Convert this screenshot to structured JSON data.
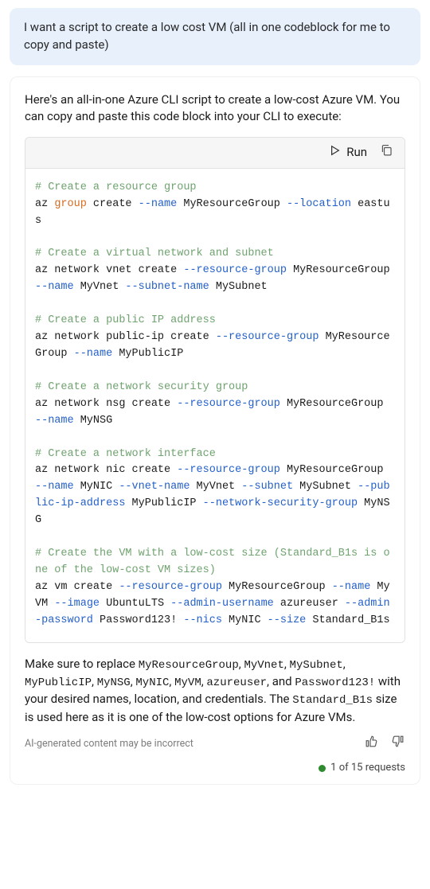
{
  "user_message": "I want a script to create a low cost VM (all in one codeblock for me to copy and paste)",
  "response_intro": "Here's an all-in-one Azure CLI script to create a low-cost Azure VM. You can copy and paste this code block into your CLI to execute:",
  "code_header": {
    "run_label": "Run"
  },
  "code": {
    "c1": "# Create a resource group",
    "l1a": "az ",
    "l1kw": "group",
    "l1b": " create ",
    "l1f1": "--name",
    "l1c": " MyResourceGroup ",
    "l1f2": "--location",
    "l1d": " eastus",
    "c2": "# Create a virtual network and subnet",
    "l2a": "az network vnet create ",
    "l2f1": "--resource-group",
    "l2b": " MyResourceGroup ",
    "l2f2": "--name",
    "l2c": " MyVnet ",
    "l2f3": "--subnet-name",
    "l2d": " MySubnet",
    "c3": "# Create a public IP address",
    "l3a": "az network public-ip create ",
    "l3f1": "--resource-group",
    "l3b": " MyResourceGroup ",
    "l3f2": "--name",
    "l3c": " MyPublicIP",
    "c4": "# Create a network security group",
    "l4a": "az network nsg create ",
    "l4f1": "--resource-group",
    "l4b": " MyResourceGroup ",
    "l4f2": "--name",
    "l4c": " MyNSG",
    "c5": "# Create a network interface",
    "l5a": "az network nic create ",
    "l5f1": "--resource-group",
    "l5b": " MyResourceGroup ",
    "l5f2": "--name",
    "l5c": " MyNIC ",
    "l5f3": "--vnet-name",
    "l5d": " MyVnet ",
    "l5f4": "--subnet",
    "l5e": " MySubnet ",
    "l5f5": "--public-ip-address",
    "l5g": " MyPublicIP ",
    "l5f6": "--network-security-group",
    "l5h": " MyNSG",
    "c6": "# Create the VM with a low-cost size (Standard_B1s is one of the low-cost VM sizes)",
    "l6a": "az vm create ",
    "l6f1": "--resource-group",
    "l6b": " MyResourceGroup ",
    "l6f2": "--name",
    "l6c": " MyVM ",
    "l6f3": "--image",
    "l6d": " UbuntuLTS ",
    "l6f4": "--admin-username",
    "l6e": " azureuser ",
    "l6f5": "--admin-password",
    "l6g": " Password123! ",
    "l6f6": "--nics",
    "l6h": " MyNIC ",
    "l6f7": "--size",
    "l6i": " Standard_B1s"
  },
  "outro": {
    "t1": "Make sure to replace ",
    "m1": "MyResourceGroup",
    "t2": ", ",
    "m2": "MyVnet",
    "t3": ", ",
    "m3": "MySubnet",
    "t4": ", ",
    "m4": "MyPublicIP",
    "t5": ", ",
    "m5": "MyNSG",
    "t6": ", ",
    "m6": "MyNIC",
    "t7": ", ",
    "m7": "MyVM",
    "t8": ", ",
    "m8": "azureuser",
    "t9": ", and ",
    "m9": "Password123!",
    "t10": " with your desired names, location, and credentials. The ",
    "m10": "Standard_B1s",
    "t11": " size is used here as it is one of the low-cost options for Azure VMs."
  },
  "disclaimer": "AI-generated content may be incorrect",
  "requests_text": "1 of 15 requests"
}
